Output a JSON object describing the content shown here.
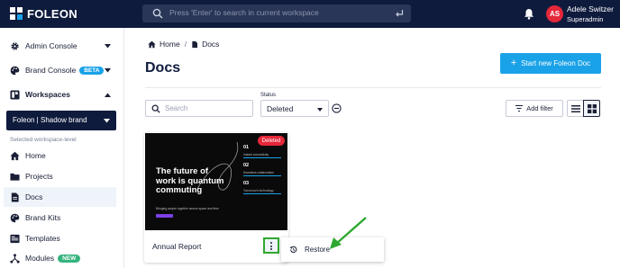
{
  "topbar": {
    "logo_text": "FOLEON",
    "search_placeholder": "Press 'Enter' to search in current workspace",
    "user_initials": "AS",
    "user_name": "Adele Switzer",
    "user_role": "Superadmin"
  },
  "sidebar": {
    "admin_console": "Admin Console",
    "brand_console": "Brand Console",
    "brand_console_badge": "BETA",
    "workspaces": "Workspaces",
    "workspace_selected": "Foleon | Shadow brand",
    "workspace_level": "Selected workspace-level",
    "items": [
      {
        "label": "Home"
      },
      {
        "label": "Projects"
      },
      {
        "label": "Docs"
      },
      {
        "label": "Brand Kits"
      },
      {
        "label": "Templates"
      },
      {
        "label": "Modules",
        "badge": "NEW"
      }
    ]
  },
  "breadcrumb": {
    "home": "Home",
    "separator": "/",
    "current": "Docs"
  },
  "page": {
    "title": "Docs",
    "start_button": "Start new Foleon Doc",
    "start_button_plus": "+"
  },
  "filters": {
    "search_placeholder": "Search",
    "status_label": "Status",
    "status_value": "Deleted",
    "add_filter": "Add filter"
  },
  "card": {
    "name": "Annual Report",
    "badge": "Deleted",
    "thumbnail": {
      "title": "The future of work is quantum commuting",
      "subtitle": "Bringing people together across space and time",
      "points": [
        {
          "num": "01",
          "caption": "Instant connectivity"
        },
        {
          "num": "02",
          "caption": "Seamless collaboration"
        },
        {
          "num": "03",
          "caption": "Tomorrow's technology"
        }
      ]
    }
  },
  "context_menu": {
    "restore": "Restore"
  },
  "colors": {
    "navy": "#0f1b3d",
    "accent": "#1aa2e8",
    "danger": "#e5273a",
    "highlight_green": "#2fa82f",
    "beta_badge": "#1aa2e8",
    "new_badge": "#35b37e"
  }
}
